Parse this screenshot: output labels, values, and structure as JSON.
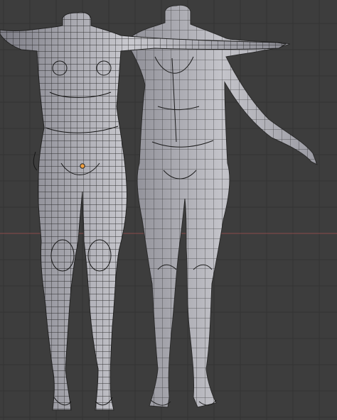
{
  "viewport": {
    "background_color": "#3d3d3d",
    "grid_color": "#333333",
    "grid_visible": true,
    "x_axis_color": "#8a4a4a",
    "mesh_fill_color": "#bdbdc4",
    "mesh_shadow_color": "#7d7d86",
    "wire_color": "#1a1a1a",
    "object_origin_color": "#f0a040"
  },
  "objects": [
    {
      "label": "",
      "pose": "t-pose",
      "display": "solid-wireframe",
      "selected": true,
      "origin_marker": "object-origin-icon"
    },
    {
      "label": "",
      "pose": "a-pose",
      "display": "solid-wireframe",
      "selected": false
    }
  ]
}
